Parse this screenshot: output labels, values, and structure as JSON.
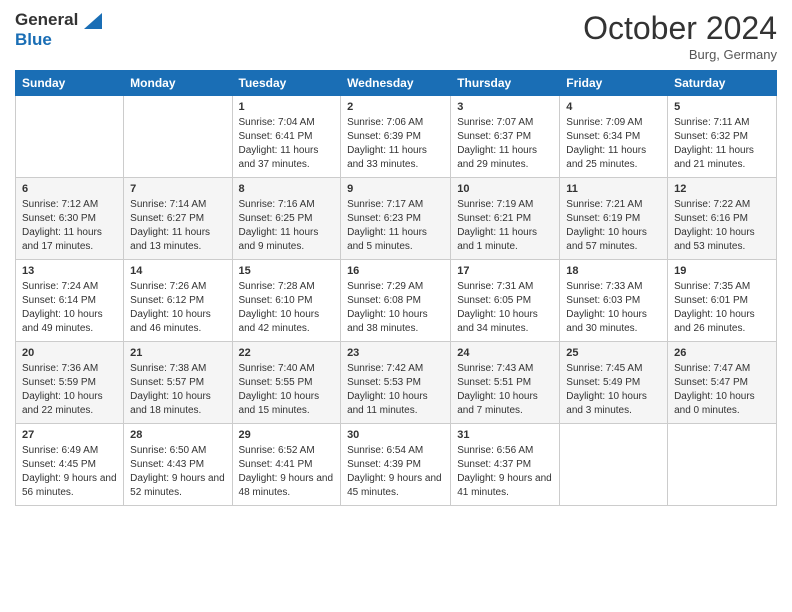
{
  "header": {
    "logo_line1": "General",
    "logo_line2": "Blue",
    "month": "October 2024",
    "location": "Burg, Germany"
  },
  "weekdays": [
    "Sunday",
    "Monday",
    "Tuesday",
    "Wednesday",
    "Thursday",
    "Friday",
    "Saturday"
  ],
  "weeks": [
    [
      {
        "day": "",
        "sunrise": "",
        "sunset": "",
        "daylight": ""
      },
      {
        "day": "",
        "sunrise": "",
        "sunset": "",
        "daylight": ""
      },
      {
        "day": "1",
        "sunrise": "Sunrise: 7:04 AM",
        "sunset": "Sunset: 6:41 PM",
        "daylight": "Daylight: 11 hours and 37 minutes."
      },
      {
        "day": "2",
        "sunrise": "Sunrise: 7:06 AM",
        "sunset": "Sunset: 6:39 PM",
        "daylight": "Daylight: 11 hours and 33 minutes."
      },
      {
        "day": "3",
        "sunrise": "Sunrise: 7:07 AM",
        "sunset": "Sunset: 6:37 PM",
        "daylight": "Daylight: 11 hours and 29 minutes."
      },
      {
        "day": "4",
        "sunrise": "Sunrise: 7:09 AM",
        "sunset": "Sunset: 6:34 PM",
        "daylight": "Daylight: 11 hours and 25 minutes."
      },
      {
        "day": "5",
        "sunrise": "Sunrise: 7:11 AM",
        "sunset": "Sunset: 6:32 PM",
        "daylight": "Daylight: 11 hours and 21 minutes."
      }
    ],
    [
      {
        "day": "6",
        "sunrise": "Sunrise: 7:12 AM",
        "sunset": "Sunset: 6:30 PM",
        "daylight": "Daylight: 11 hours and 17 minutes."
      },
      {
        "day": "7",
        "sunrise": "Sunrise: 7:14 AM",
        "sunset": "Sunset: 6:27 PM",
        "daylight": "Daylight: 11 hours and 13 minutes."
      },
      {
        "day": "8",
        "sunrise": "Sunrise: 7:16 AM",
        "sunset": "Sunset: 6:25 PM",
        "daylight": "Daylight: 11 hours and 9 minutes."
      },
      {
        "day": "9",
        "sunrise": "Sunrise: 7:17 AM",
        "sunset": "Sunset: 6:23 PM",
        "daylight": "Daylight: 11 hours and 5 minutes."
      },
      {
        "day": "10",
        "sunrise": "Sunrise: 7:19 AM",
        "sunset": "Sunset: 6:21 PM",
        "daylight": "Daylight: 11 hours and 1 minute."
      },
      {
        "day": "11",
        "sunrise": "Sunrise: 7:21 AM",
        "sunset": "Sunset: 6:19 PM",
        "daylight": "Daylight: 10 hours and 57 minutes."
      },
      {
        "day": "12",
        "sunrise": "Sunrise: 7:22 AM",
        "sunset": "Sunset: 6:16 PM",
        "daylight": "Daylight: 10 hours and 53 minutes."
      }
    ],
    [
      {
        "day": "13",
        "sunrise": "Sunrise: 7:24 AM",
        "sunset": "Sunset: 6:14 PM",
        "daylight": "Daylight: 10 hours and 49 minutes."
      },
      {
        "day": "14",
        "sunrise": "Sunrise: 7:26 AM",
        "sunset": "Sunset: 6:12 PM",
        "daylight": "Daylight: 10 hours and 46 minutes."
      },
      {
        "day": "15",
        "sunrise": "Sunrise: 7:28 AM",
        "sunset": "Sunset: 6:10 PM",
        "daylight": "Daylight: 10 hours and 42 minutes."
      },
      {
        "day": "16",
        "sunrise": "Sunrise: 7:29 AM",
        "sunset": "Sunset: 6:08 PM",
        "daylight": "Daylight: 10 hours and 38 minutes."
      },
      {
        "day": "17",
        "sunrise": "Sunrise: 7:31 AM",
        "sunset": "Sunset: 6:05 PM",
        "daylight": "Daylight: 10 hours and 34 minutes."
      },
      {
        "day": "18",
        "sunrise": "Sunrise: 7:33 AM",
        "sunset": "Sunset: 6:03 PM",
        "daylight": "Daylight: 10 hours and 30 minutes."
      },
      {
        "day": "19",
        "sunrise": "Sunrise: 7:35 AM",
        "sunset": "Sunset: 6:01 PM",
        "daylight": "Daylight: 10 hours and 26 minutes."
      }
    ],
    [
      {
        "day": "20",
        "sunrise": "Sunrise: 7:36 AM",
        "sunset": "Sunset: 5:59 PM",
        "daylight": "Daylight: 10 hours and 22 minutes."
      },
      {
        "day": "21",
        "sunrise": "Sunrise: 7:38 AM",
        "sunset": "Sunset: 5:57 PM",
        "daylight": "Daylight: 10 hours and 18 minutes."
      },
      {
        "day": "22",
        "sunrise": "Sunrise: 7:40 AM",
        "sunset": "Sunset: 5:55 PM",
        "daylight": "Daylight: 10 hours and 15 minutes."
      },
      {
        "day": "23",
        "sunrise": "Sunrise: 7:42 AM",
        "sunset": "Sunset: 5:53 PM",
        "daylight": "Daylight: 10 hours and 11 minutes."
      },
      {
        "day": "24",
        "sunrise": "Sunrise: 7:43 AM",
        "sunset": "Sunset: 5:51 PM",
        "daylight": "Daylight: 10 hours and 7 minutes."
      },
      {
        "day": "25",
        "sunrise": "Sunrise: 7:45 AM",
        "sunset": "Sunset: 5:49 PM",
        "daylight": "Daylight: 10 hours and 3 minutes."
      },
      {
        "day": "26",
        "sunrise": "Sunrise: 7:47 AM",
        "sunset": "Sunset: 5:47 PM",
        "daylight": "Daylight: 10 hours and 0 minutes."
      }
    ],
    [
      {
        "day": "27",
        "sunrise": "Sunrise: 6:49 AM",
        "sunset": "Sunset: 4:45 PM",
        "daylight": "Daylight: 9 hours and 56 minutes."
      },
      {
        "day": "28",
        "sunrise": "Sunrise: 6:50 AM",
        "sunset": "Sunset: 4:43 PM",
        "daylight": "Daylight: 9 hours and 52 minutes."
      },
      {
        "day": "29",
        "sunrise": "Sunrise: 6:52 AM",
        "sunset": "Sunset: 4:41 PM",
        "daylight": "Daylight: 9 hours and 48 minutes."
      },
      {
        "day": "30",
        "sunrise": "Sunrise: 6:54 AM",
        "sunset": "Sunset: 4:39 PM",
        "daylight": "Daylight: 9 hours and 45 minutes."
      },
      {
        "day": "31",
        "sunrise": "Sunrise: 6:56 AM",
        "sunset": "Sunset: 4:37 PM",
        "daylight": "Daylight: 9 hours and 41 minutes."
      },
      {
        "day": "",
        "sunrise": "",
        "sunset": "",
        "daylight": ""
      },
      {
        "day": "",
        "sunrise": "",
        "sunset": "",
        "daylight": ""
      }
    ]
  ]
}
